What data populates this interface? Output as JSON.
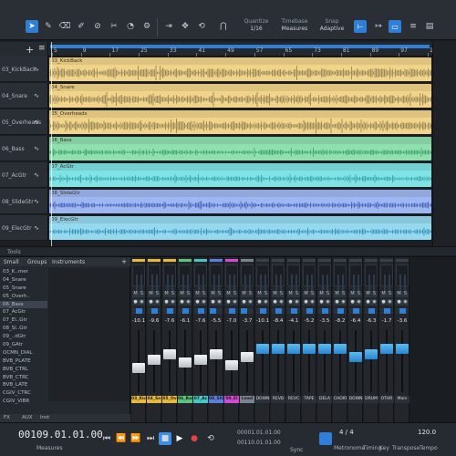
{
  "toolbar": {
    "quantize": {
      "title": "Quantize",
      "value": "1/16"
    },
    "timebase": {
      "title": "Timebase",
      "value": "Measures"
    },
    "snap": {
      "title": "Snap",
      "value": "Adaptive"
    },
    "icons": [
      "arrow-icon",
      "pencil-icon",
      "eraser-icon",
      "paint-icon",
      "mute-tool-icon",
      "split-icon",
      "listen-icon",
      "bend-icon",
      "cursor-icon",
      "move-icon",
      "magnet-icon"
    ]
  },
  "ruler": {
    "ticks": [
      "5",
      "9",
      "17",
      "25",
      "33",
      "41",
      "49",
      "57",
      "65",
      "73",
      "81",
      "89",
      "97",
      "105"
    ]
  },
  "tracks": [
    {
      "name": "03_KickBack",
      "clip": "03_KickBack",
      "color": "#f1d48a",
      "wave": "#8a7a4e"
    },
    {
      "name": "04_Snare",
      "clip": "04_Snare",
      "color": "#f1d48a",
      "wave": "#8a7a4e"
    },
    {
      "name": "05_Overheads",
      "clip": "05_Overheads",
      "color": "#f1d48a",
      "wave": "#8a7a4e"
    },
    {
      "name": "06_Bass",
      "clip": "06_Bass",
      "color": "#8fe0ae",
      "wave": "#2f9a5b"
    },
    {
      "name": "07_AcGtr",
      "clip": "07_AcGtr",
      "color": "#7fe3e3",
      "wave": "#2e9aa8"
    },
    {
      "name": "08_SlideGtr",
      "clip": "08_SlideGtr",
      "color": "#9eb7f0",
      "wave": "#3552b3"
    },
    {
      "name": "09_ElecGtr",
      "clip": "09_ElecGtr",
      "color": "#95d9ef",
      "wave": "#2a86b2"
    }
  ],
  "arrange_footer": "Tools",
  "browser": {
    "tabs": [
      "Small",
      "Groups",
      "Instruments"
    ],
    "list": [
      "03_K..mer",
      "04_Snare",
      "05_Snare",
      "05_Overh..",
      "06_Bass",
      "07_AcGtr",
      "07_El..Gtr",
      "08_Sl..Gtr",
      "09_..dGtr",
      "09_GAtr",
      "OCMN_DIAL",
      "BVB_PLATE",
      "BVB_CTRL",
      "BVB_CTRC",
      "BVB_LATE",
      "CGIV_CTRC",
      "CGIV_VIBR"
    ],
    "bottom": [
      "FX",
      "AUX",
      "Inst"
    ]
  },
  "mixer": {
    "strips": [
      {
        "label": "03_Kick",
        "color": "#e6b93b",
        "vol": "-10.1",
        "knob": "white",
        "pos": 0.6
      },
      {
        "label": "04_Sn",
        "color": "#e6b93b",
        "vol": "-9.6",
        "knob": "white",
        "pos": 0.45
      },
      {
        "label": "05_Ov",
        "color": "#e6b93b",
        "vol": "-7.6",
        "knob": "white",
        "pos": 0.35
      },
      {
        "label": "06_Bass",
        "color": "#58c77b",
        "vol": "-6.1",
        "knob": "white",
        "pos": 0.5
      },
      {
        "label": "07_Ac",
        "color": "#49c5c5",
        "vol": "-7.6",
        "knob": "white",
        "pos": 0.45
      },
      {
        "label": "08_SlGtr",
        "color": "#5b7fe0",
        "vol": "-5.5",
        "knob": "white",
        "pos": 0.35
      },
      {
        "label": "09_El",
        "color": "#d34ad3",
        "vol": "-7.0",
        "knob": "white",
        "pos": 0.55
      },
      {
        "label": "Lead",
        "color": "#7a8390",
        "vol": "-3.7",
        "knob": "white",
        "pos": 0.4
      },
      {
        "label": "DOWN",
        "color": "",
        "vol": "-10.1",
        "knob": "blue",
        "pos": 0.25
      },
      {
        "label": "REVB",
        "color": "",
        "vol": "-8.4",
        "knob": "blue",
        "pos": 0.25
      },
      {
        "label": "REVC",
        "color": "",
        "vol": "-4.1",
        "knob": "blue",
        "pos": 0.25
      },
      {
        "label": "TAPE",
        "color": "",
        "vol": "-5.2",
        "knob": "blue",
        "pos": 0.25
      },
      {
        "label": "DELA",
        "color": "",
        "vol": "-3.5",
        "knob": "blue",
        "pos": 0.25
      },
      {
        "label": "CHOIR",
        "color": "",
        "vol": "-8.2",
        "knob": "blue",
        "pos": 0.25
      },
      {
        "label": "DOWN",
        "color": "",
        "vol": "-6.4",
        "knob": "blue",
        "pos": 0.4
      },
      {
        "label": "DRUM",
        "color": "",
        "vol": "-6.3",
        "knob": "blue",
        "pos": 0.35
      },
      {
        "label": "OTHR",
        "color": "",
        "vol": "-1.7",
        "knob": "blue",
        "pos": 0.25
      },
      {
        "label": "Main",
        "color": "",
        "vol": "-3.6",
        "knob": "blue",
        "pos": 0.25
      }
    ]
  },
  "transport": {
    "position": "00109.01.01.00",
    "position_label": "Measures",
    "loop_start": "00001.01.01.00",
    "loop_end": "00110.01.01.00",
    "sync_label": "Sync",
    "time_sig": "4 / 4",
    "metronome_label": "Metronome",
    "timing_label": "Timing",
    "key_label": "Key",
    "tempo": "120.0",
    "tempo_label": "Tempo",
    "transpose_label": "Transpose"
  }
}
